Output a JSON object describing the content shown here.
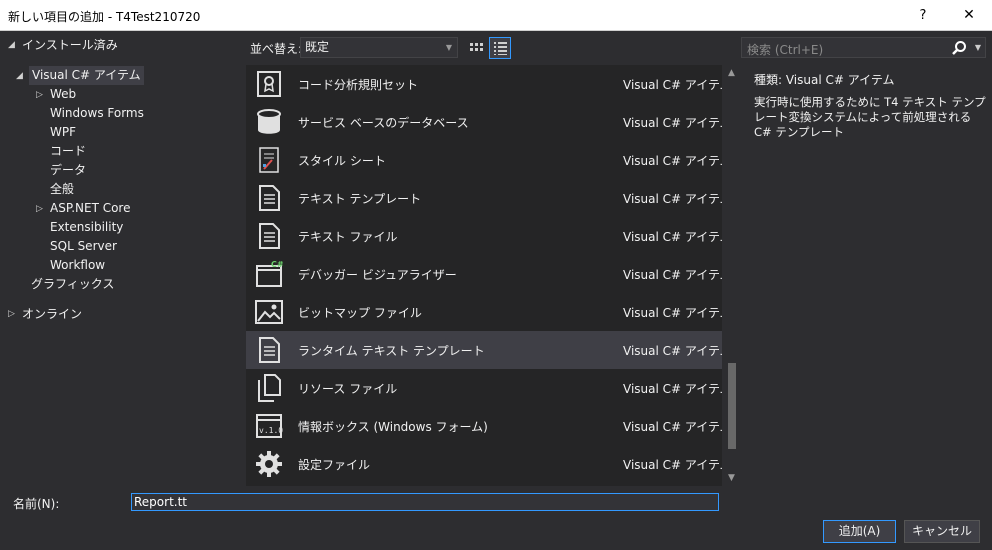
{
  "window": {
    "title": "新しい項目の追加 - T4Test210720",
    "help_label": "?",
    "close_label": "✕"
  },
  "tree": {
    "installed": "インストール済み",
    "visual_cs": "Visual C# アイテム",
    "children": [
      "Web",
      "Windows Forms",
      "WPF",
      "コード",
      "データ",
      "全般",
      "ASP.NET Core",
      "Extensibility",
      "SQL Server",
      "Workflow"
    ],
    "graphics": "グラフィックス",
    "online": "オンライン"
  },
  "toolbar": {
    "sort_label": "並べ替え:",
    "sort_value": "既定"
  },
  "search": {
    "placeholder": "検索 (Ctrl+E)"
  },
  "items": [
    {
      "name": "コード分析規則セット",
      "type": "Visual C# アイテム",
      "icon": "ruleset-icon"
    },
    {
      "name": "サービス ベースのデータベース",
      "type": "Visual C# アイテム",
      "icon": "database-icon"
    },
    {
      "name": "スタイル シート",
      "type": "Visual C# アイテム",
      "icon": "stylesheet-icon"
    },
    {
      "name": "テキスト テンプレート",
      "type": "Visual C# アイテム",
      "icon": "text-template-icon"
    },
    {
      "name": "テキスト ファイル",
      "type": "Visual C# アイテム",
      "icon": "text-file-icon"
    },
    {
      "name": "デバッガー ビジュアライザー",
      "type": "Visual C# アイテム",
      "icon": "visualizer-icon"
    },
    {
      "name": "ビットマップ ファイル",
      "type": "Visual C# アイテム",
      "icon": "bitmap-icon"
    },
    {
      "name": "ランタイム テキスト テンプレート",
      "type": "Visual C# アイテム",
      "icon": "runtime-template-icon"
    },
    {
      "name": "リソース ファイル",
      "type": "Visual C# アイテム",
      "icon": "resource-file-icon"
    },
    {
      "name": "情報ボックス (Windows フォーム)",
      "type": "Visual C# アイテム",
      "icon": "about-box-icon"
    },
    {
      "name": "設定ファイル",
      "type": "Visual C# アイテム",
      "icon": "settings-file-icon"
    }
  ],
  "selected_index": 7,
  "details": {
    "kind": "種類:  Visual C# アイテム",
    "description": "実行時に使用するために T4 テキスト テンプレート変換システムによって前処理される C# テンプレート"
  },
  "name_field": {
    "label": "名前(N):",
    "value": "Report.tt"
  },
  "buttons": {
    "add": "追加(A)",
    "cancel": "キャンセル"
  },
  "colors": {
    "background": "#2d2d30",
    "list_bg": "#252526",
    "selected": "#3f3f46",
    "accent": "#3399ff"
  }
}
